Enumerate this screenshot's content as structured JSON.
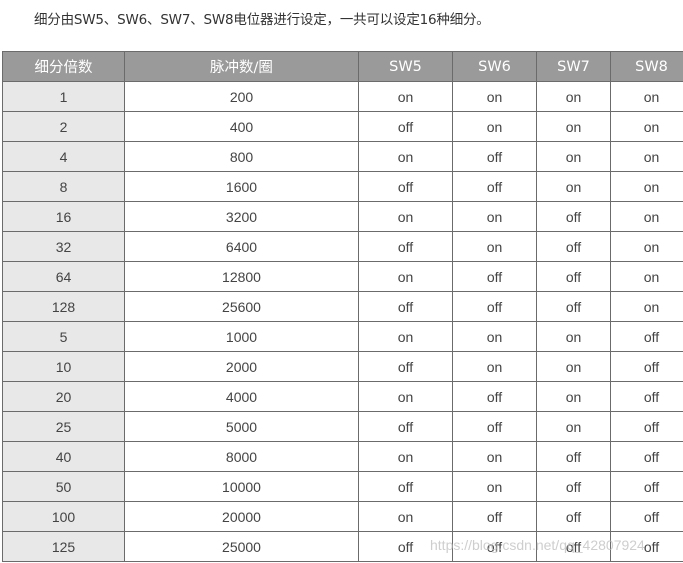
{
  "intro_text": "细分由SW5、SW6、SW7、SW8电位器进行设定，一共可以设定16种细分。",
  "table": {
    "headers": [
      "细分倍数",
      "脉冲数/圈",
      "SW5",
      "SW6",
      "SW7",
      "SW8"
    ],
    "rows": [
      [
        "1",
        "200",
        "on",
        "on",
        "on",
        "on"
      ],
      [
        "2",
        "400",
        "off",
        "on",
        "on",
        "on"
      ],
      [
        "4",
        "800",
        "on",
        "off",
        "on",
        "on"
      ],
      [
        "8",
        "1600",
        "off",
        "off",
        "on",
        "on"
      ],
      [
        "16",
        "3200",
        "on",
        "on",
        "off",
        "on"
      ],
      [
        "32",
        "6400",
        "off",
        "on",
        "off",
        "on"
      ],
      [
        "64",
        "12800",
        "on",
        "off",
        "off",
        "on"
      ],
      [
        "128",
        "25600",
        "off",
        "off",
        "off",
        "on"
      ],
      [
        "5",
        "1000",
        "on",
        "on",
        "on",
        "off"
      ],
      [
        "10",
        "2000",
        "off",
        "on",
        "on",
        "off"
      ],
      [
        "20",
        "4000",
        "on",
        "off",
        "on",
        "off"
      ],
      [
        "25",
        "5000",
        "off",
        "off",
        "on",
        "off"
      ],
      [
        "40",
        "8000",
        "on",
        "on",
        "off",
        "off"
      ],
      [
        "50",
        "10000",
        "off",
        "on",
        "off",
        "off"
      ],
      [
        "100",
        "20000",
        "on",
        "off",
        "off",
        "off"
      ],
      [
        "125",
        "25000",
        "off",
        "off",
        "off",
        "off"
      ]
    ]
  },
  "watermark": "https://blog.csdn.net/qq_42807924",
  "colors": {
    "header_bg": "#9a9a9a",
    "first_col_bg": "#e8e8e8",
    "border": "#6b6b6b"
  }
}
